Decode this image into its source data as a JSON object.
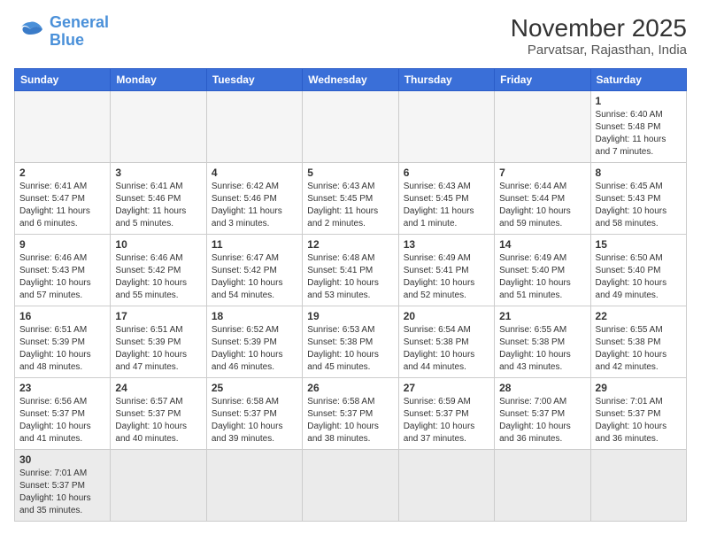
{
  "header": {
    "logo_general": "General",
    "logo_blue": "Blue",
    "month_title": "November 2025",
    "subtitle": "Parvatsar, Rajasthan, India"
  },
  "calendar": {
    "days_of_week": [
      "Sunday",
      "Monday",
      "Tuesday",
      "Wednesday",
      "Thursday",
      "Friday",
      "Saturday"
    ],
    "weeks": [
      [
        {
          "day": "",
          "info": ""
        },
        {
          "day": "",
          "info": ""
        },
        {
          "day": "",
          "info": ""
        },
        {
          "day": "",
          "info": ""
        },
        {
          "day": "",
          "info": ""
        },
        {
          "day": "",
          "info": ""
        },
        {
          "day": "1",
          "info": "Sunrise: 6:40 AM\nSunset: 5:48 PM\nDaylight: 11 hours\nand 7 minutes."
        }
      ],
      [
        {
          "day": "2",
          "info": "Sunrise: 6:41 AM\nSunset: 5:47 PM\nDaylight: 11 hours\nand 6 minutes."
        },
        {
          "day": "3",
          "info": "Sunrise: 6:41 AM\nSunset: 5:46 PM\nDaylight: 11 hours\nand 5 minutes."
        },
        {
          "day": "4",
          "info": "Sunrise: 6:42 AM\nSunset: 5:46 PM\nDaylight: 11 hours\nand 3 minutes."
        },
        {
          "day": "5",
          "info": "Sunrise: 6:43 AM\nSunset: 5:45 PM\nDaylight: 11 hours\nand 2 minutes."
        },
        {
          "day": "6",
          "info": "Sunrise: 6:43 AM\nSunset: 5:45 PM\nDaylight: 11 hours\nand 1 minute."
        },
        {
          "day": "7",
          "info": "Sunrise: 6:44 AM\nSunset: 5:44 PM\nDaylight: 10 hours\nand 59 minutes."
        },
        {
          "day": "8",
          "info": "Sunrise: 6:45 AM\nSunset: 5:43 PM\nDaylight: 10 hours\nand 58 minutes."
        }
      ],
      [
        {
          "day": "9",
          "info": "Sunrise: 6:46 AM\nSunset: 5:43 PM\nDaylight: 10 hours\nand 57 minutes."
        },
        {
          "day": "10",
          "info": "Sunrise: 6:46 AM\nSunset: 5:42 PM\nDaylight: 10 hours\nand 55 minutes."
        },
        {
          "day": "11",
          "info": "Sunrise: 6:47 AM\nSunset: 5:42 PM\nDaylight: 10 hours\nand 54 minutes."
        },
        {
          "day": "12",
          "info": "Sunrise: 6:48 AM\nSunset: 5:41 PM\nDaylight: 10 hours\nand 53 minutes."
        },
        {
          "day": "13",
          "info": "Sunrise: 6:49 AM\nSunset: 5:41 PM\nDaylight: 10 hours\nand 52 minutes."
        },
        {
          "day": "14",
          "info": "Sunrise: 6:49 AM\nSunset: 5:40 PM\nDaylight: 10 hours\nand 51 minutes."
        },
        {
          "day": "15",
          "info": "Sunrise: 6:50 AM\nSunset: 5:40 PM\nDaylight: 10 hours\nand 49 minutes."
        }
      ],
      [
        {
          "day": "16",
          "info": "Sunrise: 6:51 AM\nSunset: 5:39 PM\nDaylight: 10 hours\nand 48 minutes."
        },
        {
          "day": "17",
          "info": "Sunrise: 6:51 AM\nSunset: 5:39 PM\nDaylight: 10 hours\nand 47 minutes."
        },
        {
          "day": "18",
          "info": "Sunrise: 6:52 AM\nSunset: 5:39 PM\nDaylight: 10 hours\nand 46 minutes."
        },
        {
          "day": "19",
          "info": "Sunrise: 6:53 AM\nSunset: 5:38 PM\nDaylight: 10 hours\nand 45 minutes."
        },
        {
          "day": "20",
          "info": "Sunrise: 6:54 AM\nSunset: 5:38 PM\nDaylight: 10 hours\nand 44 minutes."
        },
        {
          "day": "21",
          "info": "Sunrise: 6:55 AM\nSunset: 5:38 PM\nDaylight: 10 hours\nand 43 minutes."
        },
        {
          "day": "22",
          "info": "Sunrise: 6:55 AM\nSunset: 5:38 PM\nDaylight: 10 hours\nand 42 minutes."
        }
      ],
      [
        {
          "day": "23",
          "info": "Sunrise: 6:56 AM\nSunset: 5:37 PM\nDaylight: 10 hours\nand 41 minutes."
        },
        {
          "day": "24",
          "info": "Sunrise: 6:57 AM\nSunset: 5:37 PM\nDaylight: 10 hours\nand 40 minutes."
        },
        {
          "day": "25",
          "info": "Sunrise: 6:58 AM\nSunset: 5:37 PM\nDaylight: 10 hours\nand 39 minutes."
        },
        {
          "day": "26",
          "info": "Sunrise: 6:58 AM\nSunset: 5:37 PM\nDaylight: 10 hours\nand 38 minutes."
        },
        {
          "day": "27",
          "info": "Sunrise: 6:59 AM\nSunset: 5:37 PM\nDaylight: 10 hours\nand 37 minutes."
        },
        {
          "day": "28",
          "info": "Sunrise: 7:00 AM\nSunset: 5:37 PM\nDaylight: 10 hours\nand 36 minutes."
        },
        {
          "day": "29",
          "info": "Sunrise: 7:01 AM\nSunset: 5:37 PM\nDaylight: 10 hours\nand 36 minutes."
        }
      ],
      [
        {
          "day": "30",
          "info": "Sunrise: 7:01 AM\nSunset: 5:37 PM\nDaylight: 10 hours\nand 35 minutes."
        },
        {
          "day": "",
          "info": ""
        },
        {
          "day": "",
          "info": ""
        },
        {
          "day": "",
          "info": ""
        },
        {
          "day": "",
          "info": ""
        },
        {
          "day": "",
          "info": ""
        },
        {
          "day": "",
          "info": ""
        }
      ]
    ]
  }
}
